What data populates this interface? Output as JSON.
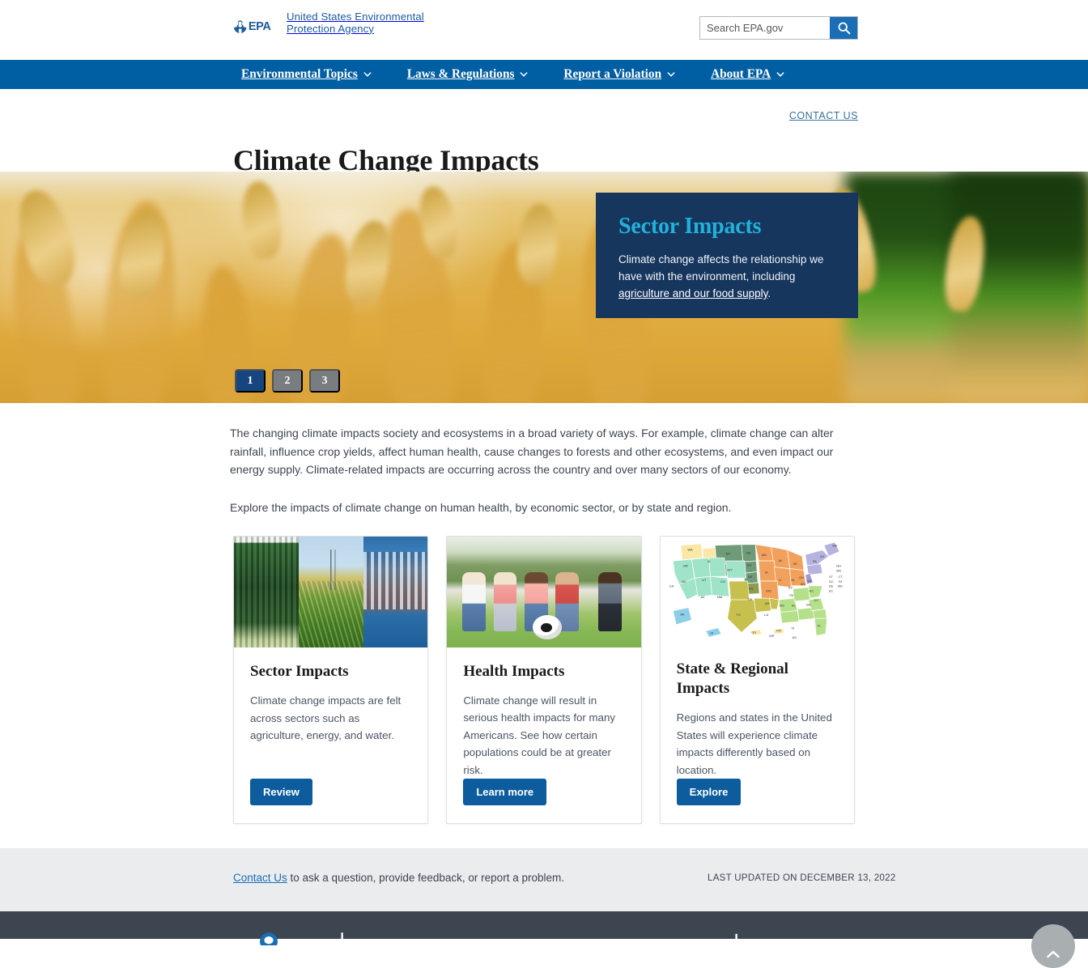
{
  "masthead": {
    "logo_alt": "EPA",
    "logo_text": "EPA",
    "agency_name": "United States Environmental Protection Agency",
    "search": {
      "placeholder": "Search EPA.gov",
      "value": "",
      "button_label": "Search",
      "icon": "search-icon"
    }
  },
  "nav": {
    "items": [
      {
        "label": "Environmental Topics",
        "icon": "chevron-down-icon"
      },
      {
        "label": "Laws & Regulations",
        "icon": "chevron-down-icon"
      },
      {
        "label": "Report a Violation",
        "icon": "chevron-down-icon"
      },
      {
        "label": "About EPA",
        "icon": "chevron-down-icon"
      }
    ],
    "background": "#005ea2"
  },
  "header": {
    "contact_us": "CONTACT US",
    "title": "Climate Change Impacts"
  },
  "hero": {
    "image_description": "Golden wheat field close-up",
    "overlay": {
      "title": "Sector Impacts",
      "text_before": "Climate change affects the relationship we have with the environment, including ",
      "link": "agriculture and our food supply",
      "text_after": ".",
      "bg": "#16365e",
      "title_color": "#21b2dc"
    },
    "carousel": {
      "slides": [
        "1",
        "2",
        "3"
      ],
      "active_index": 0,
      "active_color": "#17457f",
      "inactive_color": "#7a7d80"
    }
  },
  "intro": {
    "paragraph1": "The changing climate impacts society and ecosystems in a broad variety of ways. For example, climate change can alter rainfall, influence crop yields, affect human health, cause changes to forests and other ecosystems, and even impact our energy supply. Climate-related impacts are occurring across the country and over many sectors of our economy.",
    "paragraph2": "Explore the impacts of climate change on human health, by economic sector, or by state and region."
  },
  "cards": [
    {
      "image_description": "Triptych: pine forest, cornfield with transmission towers, city skyline on waterfront",
      "title": "Sector Impacts",
      "text": "Climate change impacts are felt across sectors such as agriculture, energy, and water.",
      "button": "Review"
    },
    {
      "image_description": "Children running on grass with a soccer ball",
      "title": "Health Impacts",
      "text": "Climate change will result in serious health impacts for many Americans. See how certain populations could be at greater risk.",
      "button": "Learn more"
    },
    {
      "image_description": "Map of the United States colored by EPA region",
      "title": "State & Regional Impacts",
      "text": "Regions and states in the United States will experience climate impacts differently based on location.",
      "button": "Explore"
    }
  ],
  "map": {
    "labels": [
      "WA",
      "OR",
      "ID",
      "MT",
      "ND",
      "MN",
      "WI",
      "MI",
      "ME",
      "NY",
      "VT",
      "NH",
      "MA",
      "CT",
      "RI",
      "NJ",
      "PA",
      "DE",
      "MD",
      "DC",
      "WV",
      "VA",
      "OH",
      "IN",
      "IL",
      "IA",
      "SD",
      "NE",
      "WY",
      "NV",
      "UT",
      "CO",
      "KS",
      "MO",
      "KY",
      "NC",
      "TN",
      "SC",
      "GA",
      "AL",
      "MS",
      "AR",
      "LA",
      "TX",
      "OK",
      "NM",
      "AZ",
      "CA",
      "FL",
      "AK",
      "HI",
      "GU",
      "PR",
      "VI",
      "MP",
      "AS"
    ]
  },
  "footer": {
    "contact_link": "Contact Us",
    "contact_rest": " to ask a question, provide feedback, or report a problem.",
    "last_updated": "LAST UPDATED ON DECEMBER 13, 2022",
    "dark_bar_color": "#3d4551",
    "to_top_label": "Back to top",
    "to_top_icon": "chevron-up-icon"
  }
}
